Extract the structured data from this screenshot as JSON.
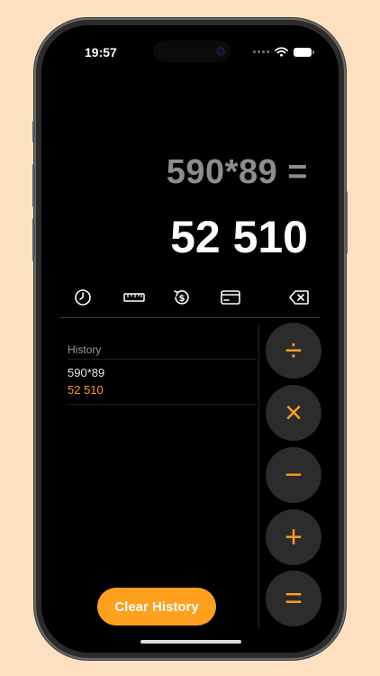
{
  "status_bar": {
    "time": "19:57"
  },
  "display": {
    "expression": "590*89 =",
    "result": "52 510"
  },
  "toolbar": {
    "icons": [
      "clock-icon",
      "ruler-icon",
      "currency-convert-icon",
      "card-icon",
      "backspace-icon"
    ]
  },
  "history": {
    "title": "History",
    "entries": [
      {
        "expression": "590*89",
        "result": "52 510"
      }
    ]
  },
  "operators": {
    "divide": "÷",
    "multiply": "×",
    "minus": "−",
    "plus": "+",
    "equals": "="
  },
  "clear_button": {
    "label": "Clear History"
  },
  "colors": {
    "accent": "#ff9a1f",
    "background": "#000000",
    "operator_bg": "#2c2c2c",
    "page_bg": "#fde0c2"
  }
}
